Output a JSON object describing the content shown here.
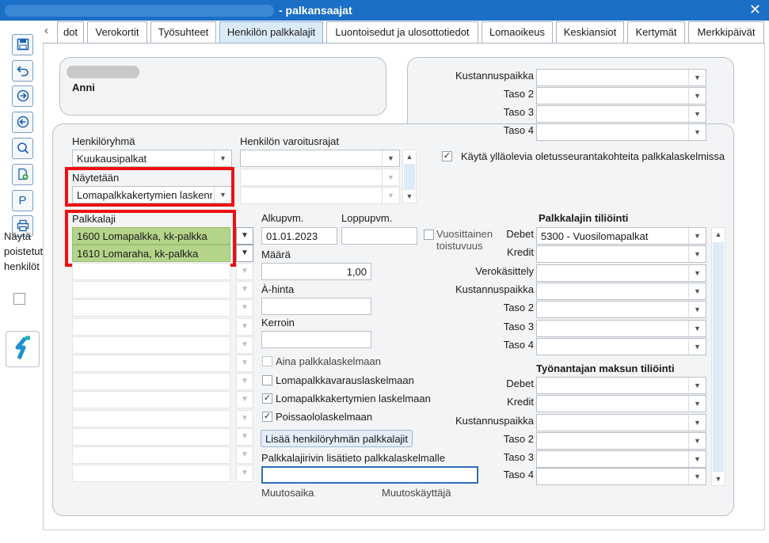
{
  "window": {
    "title": "- palkansaajat",
    "close_icon": "close-icon"
  },
  "tabs": [
    {
      "label": "dot"
    },
    {
      "label": "Verokortit"
    },
    {
      "label": "Työsuhteet"
    },
    {
      "label": "Henkilön palkkalajit",
      "active": true
    },
    {
      "label": "Luontoisedut ja ulosottotiedot"
    },
    {
      "label": "Lomaoikeus"
    },
    {
      "label": "Keskiansiot"
    },
    {
      "label": "Kertymät"
    },
    {
      "label": "Merkkipäivät"
    }
  ],
  "sidebar": {
    "show_deleted_label_1": "Näytä",
    "show_deleted_label_2": "poistetut",
    "show_deleted_label_3": "henkilöt",
    "p_button": "P"
  },
  "employee": {
    "name": "Anni"
  },
  "cost_center": {
    "kustannuspaikka_label": "Kustannuspaikka",
    "taso2_label": "Taso 2",
    "taso3_label": "Taso 3",
    "taso4_label": "Taso 4",
    "default_checkbox_label": "Käytä ylläolevia oletusseurantakohteita palkkalaskelmissa",
    "default_checkbox_checked": true
  },
  "filters": {
    "group_label": "Henkilöryhmä",
    "group_value": "Kuukausipalkat",
    "warn_label": "Henkilön varoitusrajat",
    "shown_label": "Näytetään",
    "shown_value": "Lomapalkkakertymien laskenn"
  },
  "pay_types": {
    "header": "Palkkalaji",
    "rows": [
      "1600 Lomapalkka, kk-palkka",
      "1610 Lomaraha, kk-palkka"
    ]
  },
  "detail": {
    "start_label": "Alkupvm.",
    "start_value": "01.01.2023",
    "end_label": "Loppupvm.",
    "end_value": "",
    "yearly_label_1": "Vuosittainen",
    "yearly_label_2": "toistuvuus",
    "amount_label": "Määrä",
    "amount_value": "1,00",
    "unit_price_label": "À-hinta",
    "factor_label": "Kerroin",
    "chk_always": "Aina palkkalaskelmaan",
    "chk_reserve": "Lomapalkkavarauslaskelmaan",
    "chk_accrual": "Lomapalkkakertymien laskelmaan",
    "chk_absence": "Poissaololaskelmaan",
    "add_group_button": "Lisää henkilöryhmän palkkalajit",
    "extra_info_label": "Palkkalajirivin lisätieto palkkalaskelmalle",
    "modified_time_label": "Muutosaika",
    "modified_user_label": "Muutoskäyttäjä"
  },
  "accounting": {
    "title": "Palkkalajin tiliöinti",
    "debet_label": "Debet",
    "debet_value": "5300 - Vuosilomapalkat",
    "kredit_label": "Kredit",
    "vero_label": "Verokäsittely",
    "kp_label": "Kustannuspaikka",
    "t2_label": "Taso 2",
    "t3_label": "Taso 3",
    "t4_label": "Taso 4"
  },
  "employer": {
    "title": "Työnantajan maksun tiliöinti",
    "debet_label": "Debet",
    "kredit_label": "Kredit",
    "kp_label": "Kustannuspaikka",
    "t2_label": "Taso 2",
    "t3_label": "Taso 3",
    "t4_label": "Taso 4"
  },
  "colors": {
    "titlebar": "#1b6fc6",
    "highlight": "#ee1111",
    "selected_row": "#b4d48a",
    "active_tab": "#dbeaf9"
  }
}
